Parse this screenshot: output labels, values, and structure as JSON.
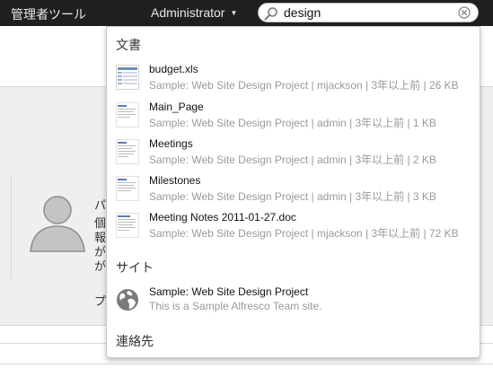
{
  "header": {
    "admin_tools": "管理者ツール",
    "user_name": "Administrator",
    "user_caret": "▼",
    "search": {
      "value": "design",
      "placeholder": ""
    }
  },
  "background": {
    "line1": "パ",
    "line2": "個",
    "line3": "報",
    "line4": "が",
    "line5": "が",
    "line6": "プ"
  },
  "dropdown": {
    "documents_heading": "文書",
    "documents": [
      {
        "title": "budget.xls",
        "meta": "Sample: Web Site Design Project | mjackson | 3年以上前 | 26 KB",
        "icon": "spreadsheet-thumbnail"
      },
      {
        "title": "Main_Page",
        "meta": "Sample: Web Site Design Project | admin | 3年以上前 | 1 KB",
        "icon": "document-thumbnail"
      },
      {
        "title": "Meetings",
        "meta": "Sample: Web Site Design Project | admin | 3年以上前 | 2 KB",
        "icon": "document-thumbnail"
      },
      {
        "title": "Milestones",
        "meta": "Sample: Web Site Design Project | admin | 3年以上前 | 3 KB",
        "icon": "document-thumbnail"
      },
      {
        "title": "Meeting Notes 2011-01-27.doc",
        "meta": "Sample: Web Site Design Project | mjackson | 3年以上前 | 72 KB",
        "icon": "document-thumbnail"
      }
    ],
    "sites_heading": "サイト",
    "sites": [
      {
        "title": "Sample: Web Site Design Project",
        "meta": "This is a Sample Alfresco Team site.",
        "icon": "globe-icon"
      }
    ],
    "people_heading": "連絡先"
  }
}
